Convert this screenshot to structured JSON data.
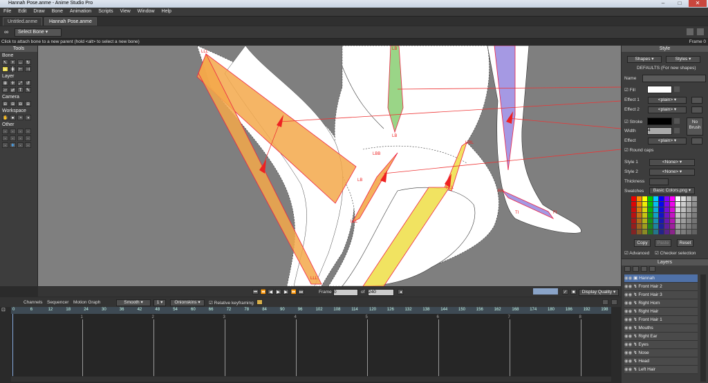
{
  "window": {
    "title": "Hannah Pose.anme - Anime Studio Pro"
  },
  "menu": [
    "File",
    "Edit",
    "Draw",
    "Bone",
    "Animation",
    "Scripts",
    "View",
    "Window",
    "Help"
  ],
  "doc_tabs": [
    {
      "label": "Untitled.anme",
      "active": false
    },
    {
      "label": "Hannah Pose.anme",
      "active": true
    }
  ],
  "tool_options": {
    "select_bone_label": "Select Bone"
  },
  "status": {
    "message": "Click to attach bone to a new parent (hold <alt> to select a new bone)",
    "frame_text": "Frame 0"
  },
  "tools": {
    "title": "Tools",
    "sections": [
      "Bone",
      "Layer",
      "Camera",
      "Workspace",
      "Other"
    ]
  },
  "bone_labels": [
    "LLL",
    "LB",
    "LB",
    "LBB",
    "LLL",
    "RLL",
    "URL",
    "RH",
    "LB",
    "LLL",
    "TI",
    "FI"
  ],
  "playback": {
    "frame_label": "Frame",
    "frame_value": "0",
    "of_label": "of",
    "total_frames": "240",
    "display_quality": "Display Quality"
  },
  "timeline": {
    "tabs": [
      "Channels",
      "Sequencer",
      "Motion Graph"
    ],
    "interp": "Smooth",
    "interp_num": "1",
    "onionskins": "Onionskins",
    "relative_kf": "Relative keyframing",
    "ruler": [
      "0",
      "6",
      "12",
      "18",
      "24",
      "30",
      "36",
      "42",
      "48",
      "54",
      "60",
      "66",
      "72",
      "78",
      "84",
      "90",
      "96",
      "102",
      "108",
      "114",
      "120",
      "126",
      "132",
      "138",
      "144",
      "150",
      "156",
      "162",
      "168",
      "174",
      "180",
      "186",
      "192",
      "198"
    ],
    "markers": [
      "1",
      "2",
      "3",
      "4",
      "5",
      "6",
      "7",
      "8"
    ]
  },
  "style_panel": {
    "title": "Style",
    "shapes_btn": "Shapes",
    "styles_btn": "Styles",
    "defaults": "DEFAULTS (For new shapes)",
    "name_label": "Name",
    "fill_label": "Fill",
    "effect1": "Effect 1",
    "effect2": "Effect 2",
    "plain": "<plain>",
    "stroke_label": "Stroke",
    "width_label": "Width",
    "width_value": "4",
    "effect_label": "Effect",
    "no_brush": "No Brush",
    "round_caps": "Round caps",
    "style1": "Style 1",
    "style2": "Style 2",
    "none": "<None>",
    "thickness": "Thickness",
    "swatches": "Swatches",
    "swatches_file": "Basic Colors.png",
    "copy": "Copy",
    "paste": "Paste",
    "reset": "Reset",
    "advanced": "Advanced",
    "checker": "Checker selection",
    "colors": {
      "fill": "#ffffff",
      "stroke": "#000000"
    }
  },
  "layers_panel": {
    "title": "Layers",
    "layers": [
      {
        "name": "Hannah",
        "selected": true
      },
      {
        "name": "Front Hair 2"
      },
      {
        "name": "Front Hair 3"
      },
      {
        "name": "Right Horn"
      },
      {
        "name": "Right Hair"
      },
      {
        "name": "Front Hair 1"
      },
      {
        "name": "Mouths"
      },
      {
        "name": "Right Ear"
      },
      {
        "name": "Eyes"
      },
      {
        "name": "Nose"
      },
      {
        "name": "Head"
      },
      {
        "name": "Left Hair"
      }
    ]
  }
}
